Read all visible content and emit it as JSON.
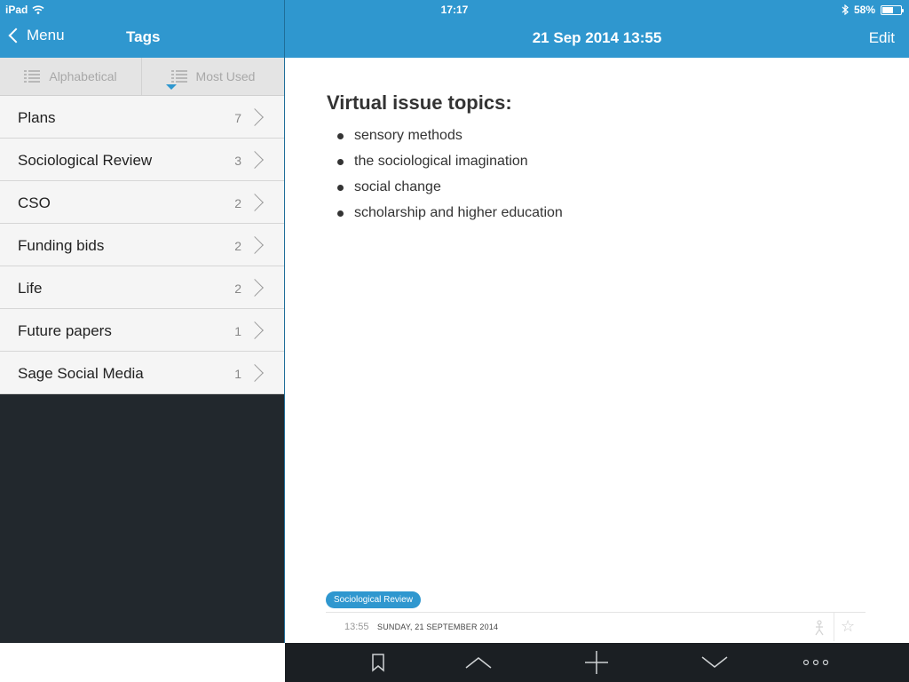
{
  "status": {
    "carrier": "iPad",
    "time": "17:17",
    "battery": "58%",
    "battery_level": 0.58
  },
  "sidebar": {
    "back_label": "Menu",
    "title": "Tags",
    "sort": {
      "alphabetical": "Alphabetical",
      "most_used": "Most Used"
    },
    "tags": [
      {
        "name": "Plans",
        "count": "7"
      },
      {
        "name": "Sociological Review",
        "count": "3"
      },
      {
        "name": "CSO",
        "count": "2"
      },
      {
        "name": "Funding bids",
        "count": "2"
      },
      {
        "name": "Life",
        "count": "2"
      },
      {
        "name": "Future papers",
        "count": "1"
      },
      {
        "name": "Sage Social Media",
        "count": "1"
      }
    ]
  },
  "note": {
    "header_title": "21 Sep 2014 13:55",
    "edit_label": "Edit",
    "heading": "Virtual issue topics:",
    "bullets": [
      "sensory methods",
      "the sociological imagination",
      "social change",
      "scholarship and higher education"
    ],
    "tag": "Sociological Review",
    "time": "13:55",
    "date": "SUNDAY, 21 SEPTEMBER 2014"
  },
  "colors": {
    "accent": "#2f97cf",
    "sidebar_dark": "#22282d",
    "toolbar": "#1b1f23"
  },
  "toolbar": {
    "icons": [
      "bookmark-icon",
      "chevron-up-icon",
      "plus-icon",
      "chevron-down-icon",
      "more-icon"
    ]
  }
}
